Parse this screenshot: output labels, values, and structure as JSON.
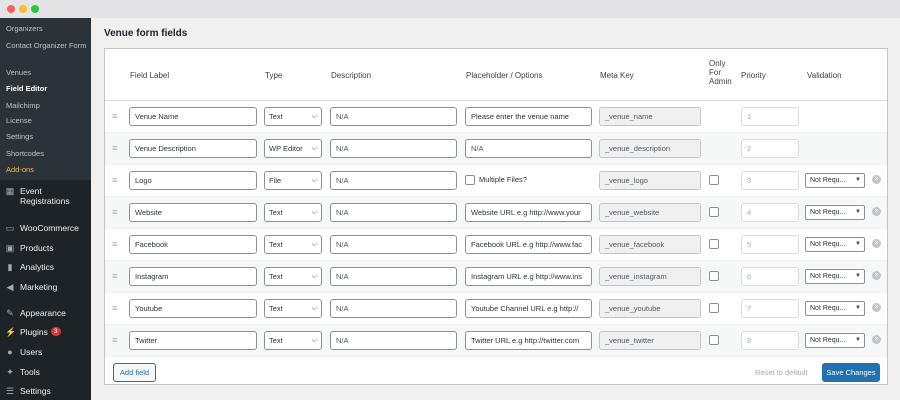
{
  "window": {
    "colors": {
      "close": "#ff5f57",
      "minimize": "#febc2e",
      "maximize": "#28c840"
    }
  },
  "sidebar": {
    "submenu": [
      {
        "label": "Organizers"
      },
      {
        "label": "Contact Organizer Form"
      },
      {
        "label": "Venues"
      },
      {
        "label": "Field Editor"
      },
      {
        "label": "Mailchimp"
      },
      {
        "label": "License"
      },
      {
        "label": "Settings"
      },
      {
        "label": "Shortcodes"
      },
      {
        "label": "Add-ons"
      }
    ],
    "menu": [
      {
        "label": "Event Registrations",
        "icon": "calendar-icon"
      },
      {
        "label": "WooCommerce",
        "icon": "woocommerce-icon"
      },
      {
        "label": "Products",
        "icon": "archive-icon"
      },
      {
        "label": "Analytics",
        "icon": "bar-chart-icon"
      },
      {
        "label": "Marketing",
        "icon": "megaphone-icon"
      },
      {
        "label": "Appearance",
        "icon": "paintbrush-icon"
      },
      {
        "label": "Plugins",
        "icon": "plug-icon",
        "badge": "3"
      },
      {
        "label": "Users",
        "icon": "users-icon"
      },
      {
        "label": "Tools",
        "icon": "wrench-icon"
      },
      {
        "label": "Settings",
        "icon": "sliders-icon"
      }
    ]
  },
  "page": {
    "title": "Venue form fields"
  },
  "table": {
    "headers": {
      "field_label": "Field Label",
      "type": "Type",
      "description": "Description",
      "placeholder": "Placeholder / Options",
      "meta_key": "Meta Key",
      "only_for_admin": "Only For Admin",
      "priority": "Priority",
      "validation": "Validation"
    },
    "rows": [
      {
        "label": "Venue Name",
        "type": "Text",
        "description": "N/A",
        "placeholder": "Please enter the venue name",
        "meta_key": "_venue_name",
        "priority": "1"
      },
      {
        "label": "Venue Description",
        "type": "WP Editor",
        "description": "N/A",
        "placeholder": "N/A",
        "meta_key": "_venue_description",
        "priority": "2"
      },
      {
        "label": "Logo",
        "type": "File",
        "description": "N/A",
        "multiple_label": "Multiple Files?",
        "meta_key": "_venue_logo",
        "priority": "3",
        "validation": "Not Requ..."
      },
      {
        "label": "Website",
        "type": "Text",
        "description": "N/A",
        "placeholder": "Website URL e.g http://www.your",
        "meta_key": "_venue_website",
        "priority": "4",
        "validation": "Not Requ..."
      },
      {
        "label": "Facebook",
        "type": "Text",
        "description": "N/A",
        "placeholder": "Facebook URL e.g http://www.fac",
        "meta_key": "_venue_facebook",
        "priority": "5",
        "validation": "Not Requ..."
      },
      {
        "label": "Instagram",
        "type": "Text",
        "description": "N/A",
        "placeholder": "Instagram URL e.g http://www.ins",
        "meta_key": "_venue_instagram",
        "priority": "6",
        "validation": "Not Requ..."
      },
      {
        "label": "Youtube",
        "type": "Text",
        "description": "N/A",
        "placeholder": "Youtube Channel URL e.g http://",
        "meta_key": "_venue_youtube",
        "priority": "7",
        "validation": "Not Requ..."
      },
      {
        "label": "Twitter",
        "type": "Text",
        "description": "N/A",
        "placeholder": "Twitter URL e.g http://twitter.com",
        "meta_key": "_venue_twitter",
        "priority": "8",
        "validation": "Not Requ..."
      }
    ]
  },
  "footer": {
    "add_field": "Add field",
    "reset": "Reset to default",
    "save": "Save Changes"
  }
}
